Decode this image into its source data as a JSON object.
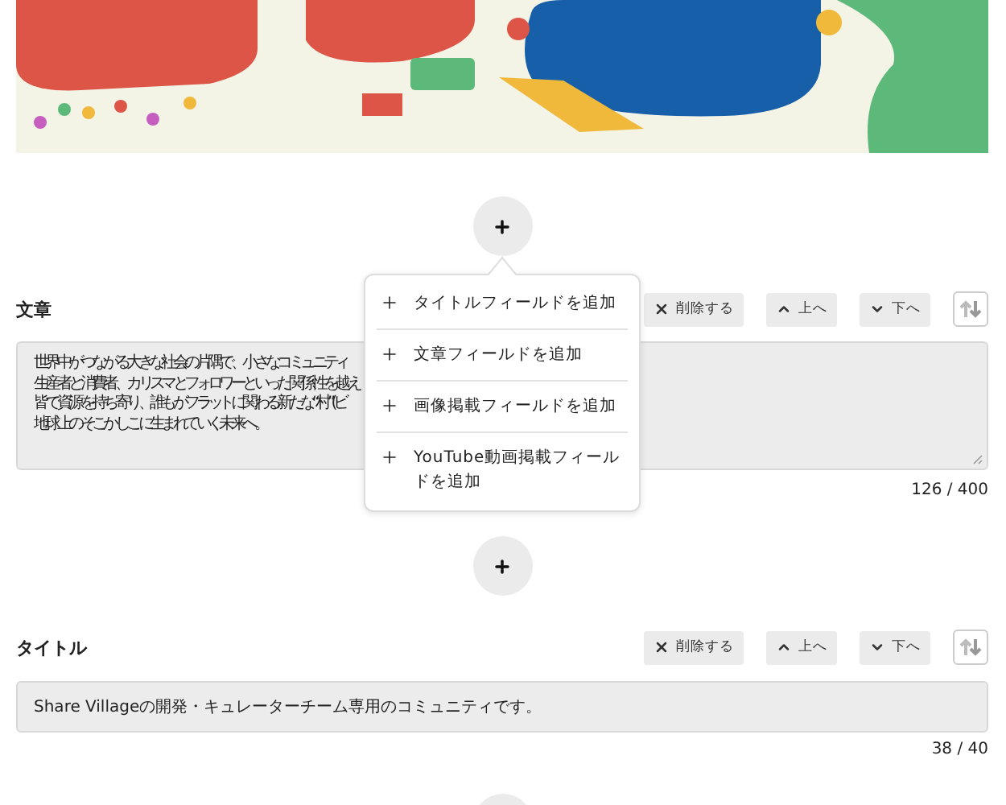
{
  "add_menu": {
    "items": [
      {
        "label": "タイトルフィールドを追加"
      },
      {
        "label": "文章フィールドを追加"
      },
      {
        "label": "画像掲載フィールドを追加"
      },
      {
        "label": "YouTube動画掲載フィールドを追加"
      }
    ]
  },
  "sections": [
    {
      "kind": "textarea",
      "label": "文章",
      "delete": "削除する",
      "up": "上へ",
      "down": "下へ",
      "value_lines": [
        "世界中がつながる大きな社会の片隅で、小さなコミュニティ",
        "生産者と消費者、カリスマとフォロワーといった関係性を越え",
        "皆で資源を持ち寄り、誰もがフラットに関わる新たな“村”(ビ",
        "地球上のそこかしこに生まれていく未来へ。"
      ],
      "counter": "126 / 400"
    },
    {
      "kind": "input",
      "label": "タイトル",
      "delete": "削除する",
      "up": "上へ",
      "down": "下へ",
      "value": "Share Villageの開発・キュレーターチーム専用のコミュニティです。",
      "counter": "38 / 40"
    }
  ]
}
